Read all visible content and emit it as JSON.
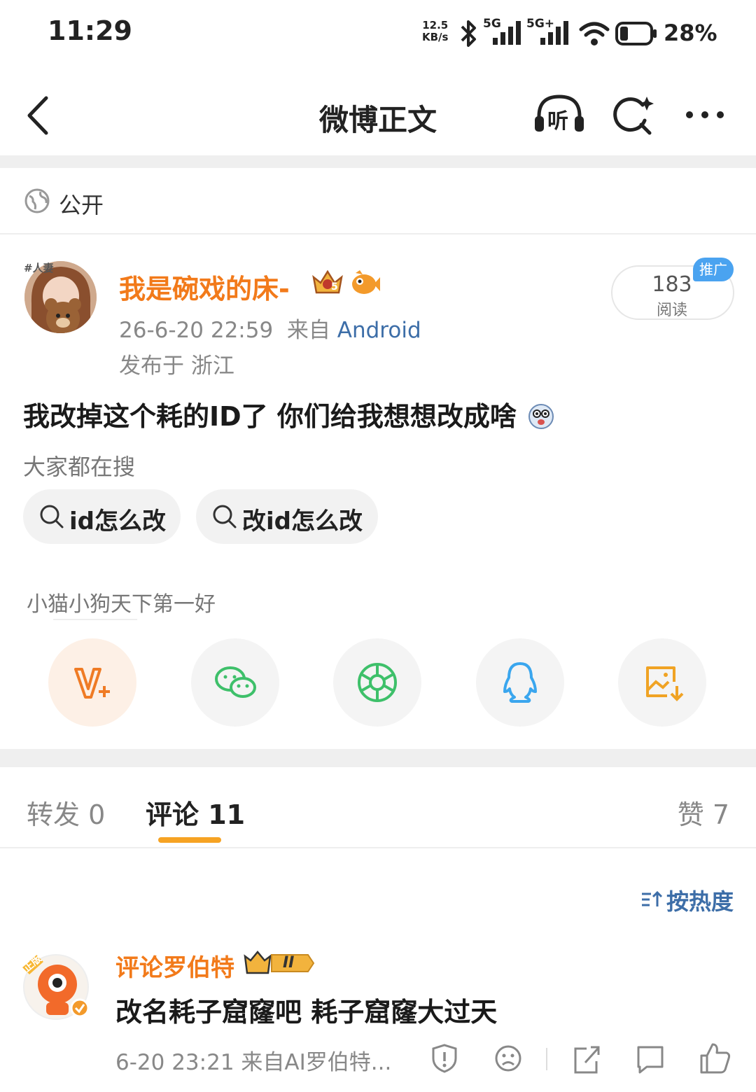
{
  "status_bar": {
    "time": "11:29",
    "net_speed_value": "12.5",
    "net_speed_unit": "KB/s",
    "sim1_label": "5G",
    "sim2_label": "5G+",
    "battery_percent": "28%",
    "battery_level": 0.28
  },
  "header": {
    "title": "微博正文",
    "listen_label": "听",
    "icons": [
      "back-arrow-icon",
      "headphones-icon",
      "search-sparkle-icon",
      "more-dots-icon"
    ]
  },
  "post": {
    "visibility": "公开",
    "avatar_tag": "#人妻",
    "author": "我是碗戏的床-",
    "badge_level": "5",
    "date": "26-6-20 22:59",
    "source_prefix": "来自",
    "source": "Android",
    "location": "发布于 浙江",
    "read_count": "183",
    "read_label": "阅读",
    "promo_tag": "推广",
    "body": "我改掉这个耗的ID了 你们给我想想改成啥",
    "search_heading": "大家都在搜",
    "search_chips": [
      "id怎么改",
      "改id怎么改"
    ],
    "supertopic": "小猫小狗天下第一好",
    "share_targets": [
      "vplus-icon",
      "wechat-icon",
      "moments-icon",
      "qq-icon",
      "save-image-icon"
    ]
  },
  "tabs": {
    "repost": "转发 0",
    "comments": "评论 11",
    "likes": "赞 7",
    "sort": "按热度"
  },
  "comment": {
    "author": "评论罗伯特",
    "avatar_badge": "正版",
    "rank_badge": "II",
    "text": "改名耗子窟窿吧 耗子窟窿大过天",
    "meta": "6-20 23:21 来自AI罗伯特...",
    "actions": [
      "report-icon",
      "dislike-icon",
      "repost-icon",
      "reply-icon",
      "like-icon"
    ]
  },
  "colors": {
    "brand_orange": "#f27a1a",
    "link_blue": "#3d6ea8",
    "tab_underline": "#f6a323",
    "promo_blue": "#4aa3f0"
  }
}
